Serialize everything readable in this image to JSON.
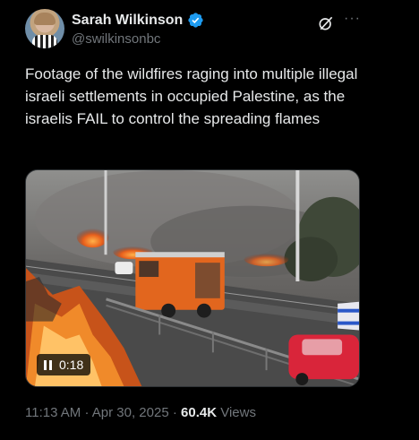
{
  "author": {
    "display_name": "Sarah Wilkinson",
    "handle": "@swilkinsonbc",
    "verified": true,
    "verified_color": "#1d9bf0"
  },
  "tweet": {
    "text": "Footage of the wildfires raging into multiple illegal israeli settlements in occupied Palestine, as the israelis FAIL to control the spreading flames"
  },
  "media": {
    "type": "video",
    "duration": "0:18",
    "state": "playing"
  },
  "meta": {
    "time": "11:13 AM",
    "sep1": "·",
    "date": "Apr 30, 2025",
    "sep2": "·",
    "views_count": "60.4K",
    "views_label": "Views"
  },
  "colors": {
    "background": "#000000",
    "text_primary": "#e7e9ea",
    "text_secondary": "#71767b"
  },
  "icons": [
    "verified-badge-icon",
    "grok-icon",
    "more-icon",
    "pause-icon"
  ]
}
